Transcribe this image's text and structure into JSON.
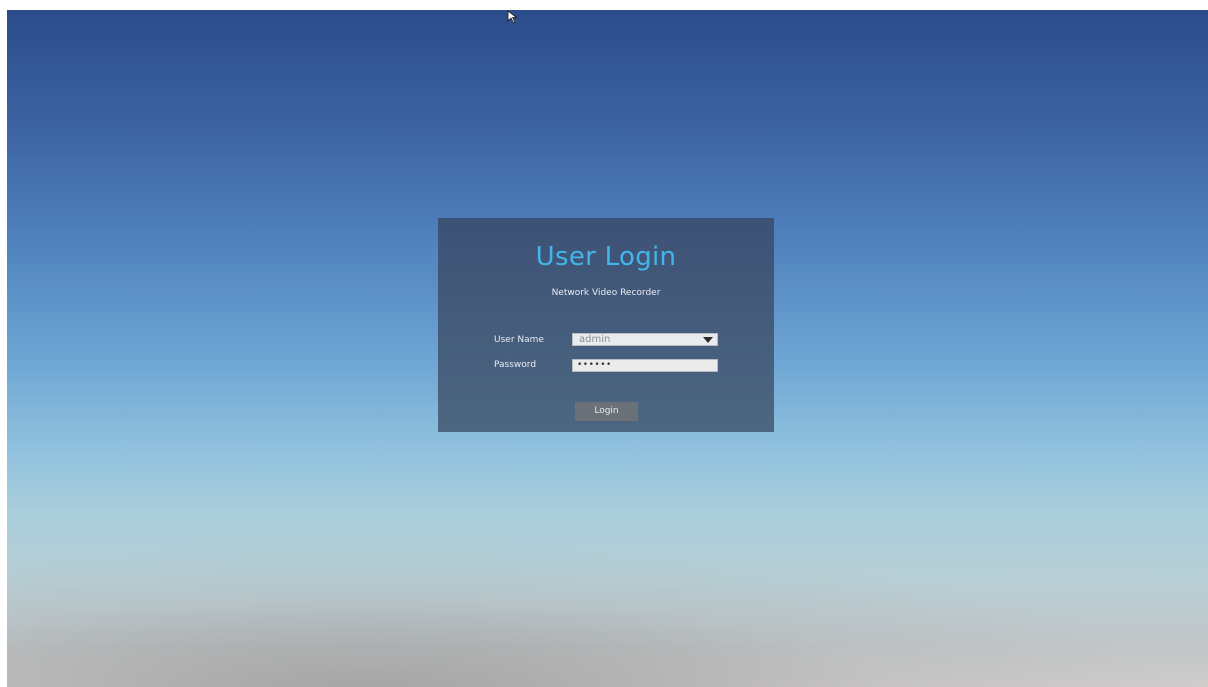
{
  "login": {
    "title": "User Login",
    "subtitle": "Network Video Recorder",
    "username_label": "User Name",
    "username_value": "admin",
    "password_label": "Password",
    "password_mask": "••••••",
    "login_button": "Login"
  },
  "icons": {
    "cursor": "mouse-pointer-icon",
    "dropdown": "chevron-down-icon"
  },
  "colors": {
    "title": "#43b5e8",
    "panel": "#3c4e70",
    "button": "#6b7178"
  }
}
